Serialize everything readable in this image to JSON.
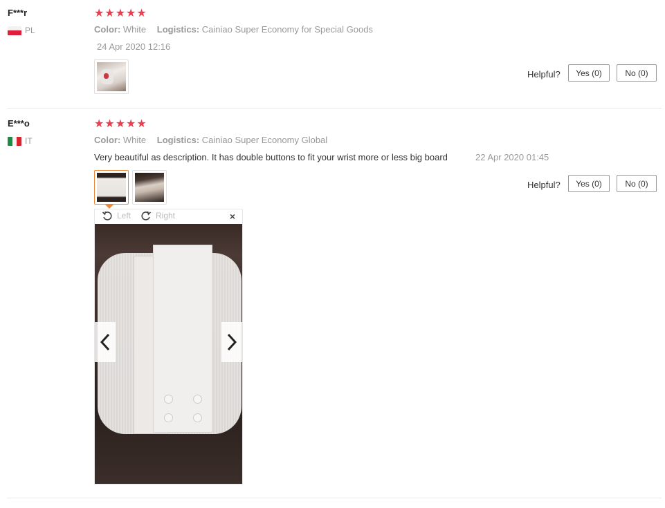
{
  "reviews": [
    {
      "user": "F***r",
      "country": "PL",
      "rating": "★★★★★",
      "color_label": "Color:",
      "color_value": "White",
      "logistics_label": "Logistics:",
      "logistics_value": "Cainiao Super Economy for Special Goods",
      "date": "24 Apr 2020 12:16",
      "helpful_label": "Helpful?",
      "yes_label": "Yes (0)",
      "no_label": "No (0)"
    },
    {
      "user": "E***o",
      "country": "IT",
      "rating": "★★★★★",
      "color_label": "Color:",
      "color_value": "White",
      "logistics_label": "Logistics:",
      "logistics_value": "Cainiao Super Economy Global",
      "feedback": "Very beautiful as description. It has double buttons to fit your wrist more or less big board",
      "date": "22 Apr 2020 01:45",
      "helpful_label": "Helpful?",
      "yes_label": "Yes (0)",
      "no_label": "No (0)"
    }
  ],
  "viewer": {
    "rotate_left_label": "Left",
    "rotate_right_label": "Right",
    "close_glyph": "×"
  },
  "colors": {
    "star": "#ec3d4f",
    "active_thumb_border": "#e88a3d"
  },
  "icons": [
    "rotate-left-icon",
    "rotate-right-icon",
    "close-icon",
    "chevron-left-icon",
    "chevron-right-icon"
  ]
}
